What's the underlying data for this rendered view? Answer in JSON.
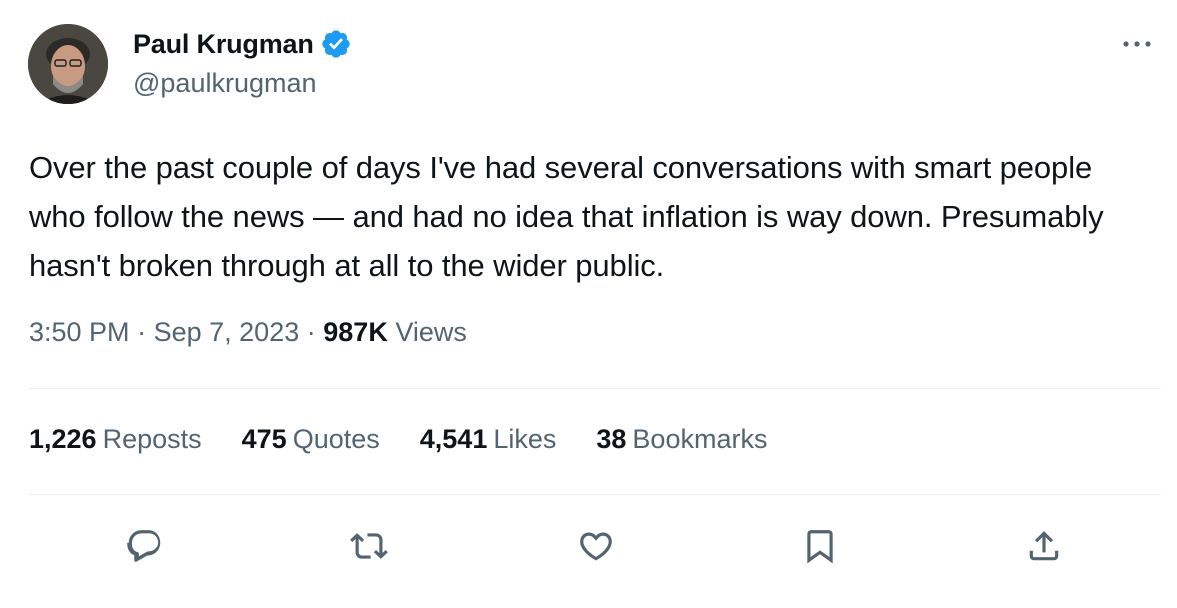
{
  "author": {
    "display_name": "Paul Krugman",
    "handle": "@paulkrugman",
    "verified": true
  },
  "tweet": {
    "text": "Over the past couple of days I've had several conversations with smart people who follow the news — and had no idea that inflation is way down. Presumably hasn't broken through at all to the wider public.",
    "time": "3:50 PM",
    "separator": "·",
    "date": "Sep 7, 2023",
    "views_count": "987K",
    "views_label": "Views"
  },
  "stats": {
    "reposts": {
      "count": "1,226",
      "label": "Reposts"
    },
    "quotes": {
      "count": "475",
      "label": "Quotes"
    },
    "likes": {
      "count": "4,541",
      "label": "Likes"
    },
    "bookmarks": {
      "count": "38",
      "label": "Bookmarks"
    }
  },
  "icons": {
    "more": "more-horizontal-icon",
    "reply": "reply-icon",
    "repost": "repost-icon",
    "like": "heart-icon",
    "bookmark": "bookmark-icon",
    "share": "share-icon",
    "verified": "verified-badge-icon"
  },
  "colors": {
    "text_primary": "#0f1419",
    "text_secondary": "#536471",
    "verified_blue": "#1d9bf0",
    "divider": "#eff3f4"
  }
}
